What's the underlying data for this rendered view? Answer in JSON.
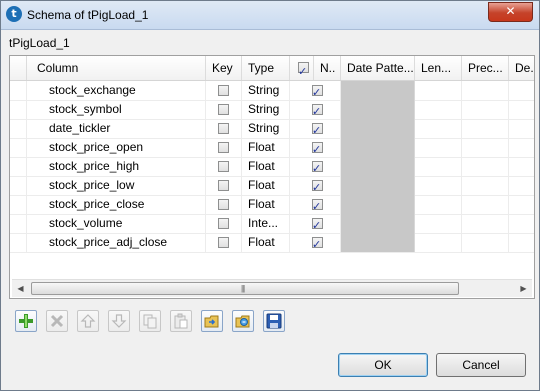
{
  "window": {
    "title": "Schema of tPigLoad_1",
    "close_label": "✕"
  },
  "component_label": "tPigLoad_1",
  "columns": {
    "column": "Column",
    "key": "Key",
    "type": "Type",
    "nullable": "N..",
    "date_pattern": "Date Patte...",
    "length": "Len...",
    "precision": "Prec...",
    "default": "De..."
  },
  "rows": [
    {
      "name": "stock_exchange",
      "key": false,
      "type": "String",
      "nullable": true
    },
    {
      "name": "stock_symbol",
      "key": false,
      "type": "String",
      "nullable": true
    },
    {
      "name": "date_tickler",
      "key": false,
      "type": "String",
      "nullable": true
    },
    {
      "name": "stock_price_open",
      "key": false,
      "type": "Float",
      "nullable": true
    },
    {
      "name": "stock_price_high",
      "key": false,
      "type": "Float",
      "nullable": true
    },
    {
      "name": "stock_price_low",
      "key": false,
      "type": "Float",
      "nullable": true
    },
    {
      "name": "stock_price_close",
      "key": false,
      "type": "Float",
      "nullable": true
    },
    {
      "name": "stock_volume",
      "key": false,
      "type": "Inte...",
      "nullable": true
    },
    {
      "name": "stock_price_adj_close",
      "key": false,
      "type": "Float",
      "nullable": true
    }
  ],
  "scrollbar": {
    "left_arrow": "◀",
    "right_arrow": "▶",
    "grip": "|||"
  },
  "toolbar": [
    {
      "icon": "add-icon",
      "enabled": true
    },
    {
      "icon": "remove-icon",
      "enabled": false
    },
    {
      "icon": "move-up-icon",
      "enabled": false
    },
    {
      "icon": "move-down-icon",
      "enabled": false
    },
    {
      "icon": "copy-icon",
      "enabled": false
    },
    {
      "icon": "paste-icon",
      "enabled": false
    },
    {
      "icon": "import-icon",
      "enabled": true
    },
    {
      "icon": "export-icon",
      "enabled": true
    },
    {
      "icon": "save-icon",
      "enabled": true
    }
  ],
  "buttons": {
    "ok": "OK",
    "cancel": "Cancel"
  },
  "colors": {
    "check": "#21359b",
    "disabled_cell": "#c8c8c8",
    "accent": "#3c7fb1"
  }
}
